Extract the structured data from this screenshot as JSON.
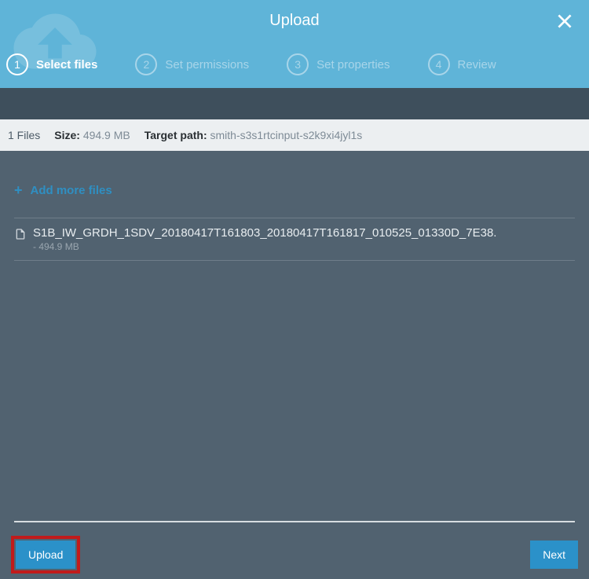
{
  "header": {
    "title": "Upload"
  },
  "steps": [
    {
      "num": "1",
      "label": "Select files"
    },
    {
      "num": "2",
      "label": "Set permissions"
    },
    {
      "num": "3",
      "label": "Set properties"
    },
    {
      "num": "4",
      "label": "Review"
    }
  ],
  "info": {
    "files_count": "1 Files",
    "size_label": "Size:",
    "size_value": "494.9 MB",
    "target_label": "Target path:",
    "target_value": "smith-s3s1rtcinput-s2k9xi4jyl1s"
  },
  "add_more_label": "Add more files",
  "file": {
    "name": "S1B_IW_GRDH_1SDV_20180417T161803_20180417T161817_010525_01330D_7E38.",
    "size": "- 494.9 MB"
  },
  "buttons": {
    "upload": "Upload",
    "next": "Next"
  }
}
